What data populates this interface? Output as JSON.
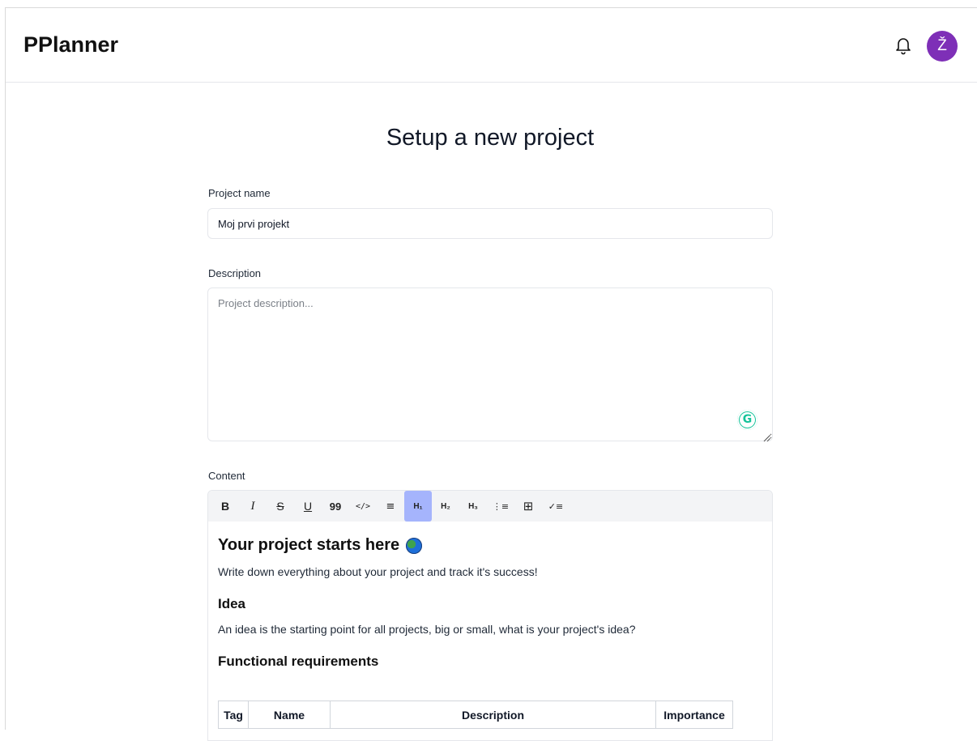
{
  "app": {
    "title": "PPlanner",
    "avatar_initial": "Ž",
    "avatar_color": "#7e2fb7"
  },
  "header": {
    "notifications_icon": "bell-icon"
  },
  "page": {
    "title": "Setup a new project"
  },
  "form": {
    "project_name_label": "Project name",
    "project_name_value": "Moj prvi projekt",
    "description_label": "Description",
    "description_placeholder": "Project description...",
    "content_label": "Content"
  },
  "toolbar": {
    "bold": "B",
    "italic": "I",
    "strike": "S",
    "underline": "U",
    "quote": "99",
    "code": "</>",
    "paragraph": "≡",
    "h1": "H₁",
    "h2": "H₂",
    "h3": "H₃",
    "ordered_list": "⋮≡",
    "table": "⊞",
    "task_list": "✓≡",
    "active_color": "#a5b4fc"
  },
  "editor": {
    "heading": "Your project starts here",
    "heading_emoji": "globe-icon",
    "intro": "Write down everything about your project and track it's success!",
    "idea_heading": "Idea",
    "idea_text": "An idea is the starting point for all projects, big or small, what is your project's idea?",
    "func_req_heading": "Functional requirements",
    "table_headers": [
      "Tag",
      "Name",
      "Description",
      "Importance"
    ]
  }
}
